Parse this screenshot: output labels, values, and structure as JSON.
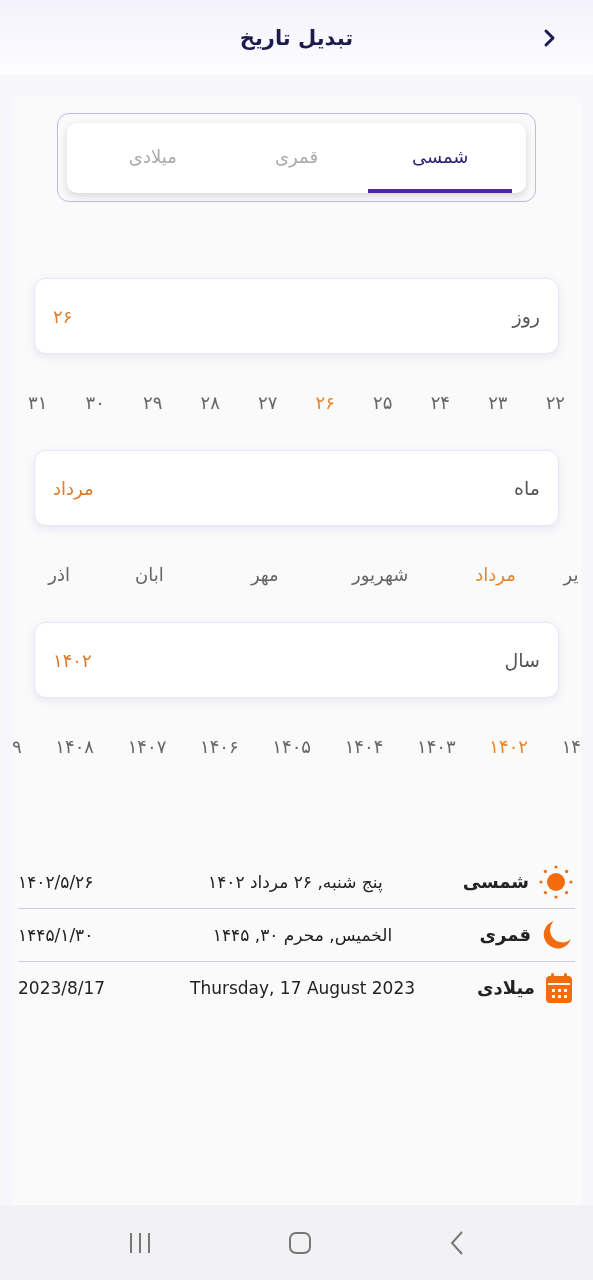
{
  "header": {
    "title": "تبدیل تاریخ"
  },
  "tabs": [
    {
      "label": "شمسی",
      "selected": true
    },
    {
      "label": "قمری",
      "selected": false
    },
    {
      "label": "میلادی",
      "selected": false
    }
  ],
  "pickers": [
    {
      "kind": "day",
      "label": "روز",
      "value": "۲۶",
      "options": [
        {
          "text": "۲۲",
          "selected": false
        },
        {
          "text": "۲۳",
          "selected": false
        },
        {
          "text": "۲۴",
          "selected": false
        },
        {
          "text": "۲۵",
          "selected": false
        },
        {
          "text": "۲۶",
          "selected": true
        },
        {
          "text": "۲۷",
          "selected": false
        },
        {
          "text": "۲۸",
          "selected": false
        },
        {
          "text": "۲۹",
          "selected": false
        },
        {
          "text": "۳۰",
          "selected": false
        },
        {
          "text": "۳۱",
          "selected": false
        }
      ]
    },
    {
      "kind": "month",
      "label": "ماه",
      "value": "مرداد",
      "options": [
        {
          "text": "یر",
          "selected": false
        },
        {
          "text": "مرداد",
          "selected": true
        },
        {
          "text": "شهریور",
          "selected": false
        },
        {
          "text": "مهر",
          "selected": false
        },
        {
          "text": "ابان",
          "selected": false
        },
        {
          "text": "اذر",
          "selected": false
        }
      ]
    },
    {
      "kind": "year",
      "label": "سال",
      "value": "۱۴۰۲",
      "options": [
        {
          "text": "۱۴",
          "selected": false
        },
        {
          "text": "۱۴۰۲",
          "selected": true
        },
        {
          "text": "۱۴۰۳",
          "selected": false
        },
        {
          "text": "۱۴۰۴",
          "selected": false
        },
        {
          "text": "۱۴۰۵",
          "selected": false
        },
        {
          "text": "۱۴۰۶",
          "selected": false
        },
        {
          "text": "۱۴۰۷",
          "selected": false
        },
        {
          "text": "۱۴۰۸",
          "selected": false
        },
        {
          "text": "۹",
          "selected": false
        }
      ]
    }
  ],
  "results": [
    {
      "kind": "sun",
      "label": "شمسی",
      "long": "پنج شنبه, ۲۶ مرداد ۱۴۰۲",
      "short": "۱۴۰۲/۵/۲۶"
    },
    {
      "kind": "moon",
      "label": "قمری",
      "long": "الخمیس, محرم ۳۰, ۱۴۴۵",
      "short": "۱۴۴۵/۱/۳۰"
    },
    {
      "kind": "calendar",
      "label": "میلادی",
      "long": "Thursday, 17 August 2023",
      "short": "2023/8/17"
    }
  ]
}
